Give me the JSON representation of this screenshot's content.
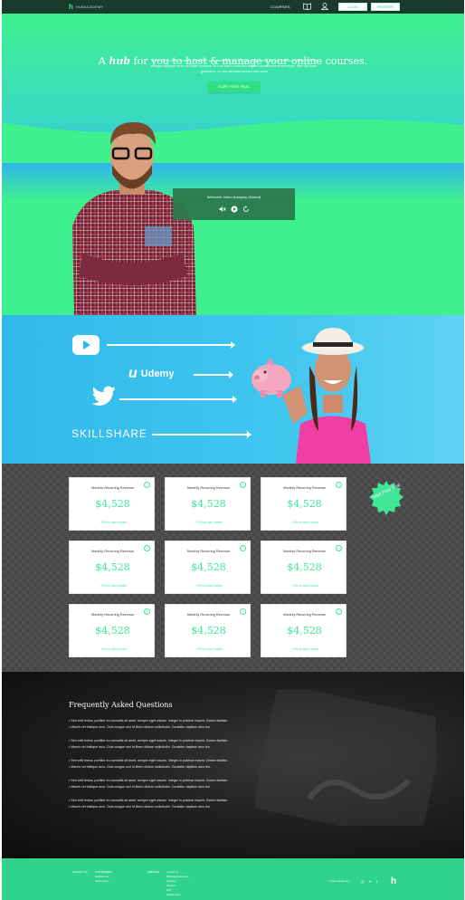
{
  "nav": {
    "logo_text": "HUBACADEMY",
    "courses": "COURSES",
    "login": "LOGIN",
    "register": "REGISTER"
  },
  "hero": {
    "title_pre": "A",
    "title_bold": "hub",
    "title_post": "for you to host & manage your online courses.",
    "subtitle": "Lorem ipsum dolor sit amet, consetetur sadipscing elitr, sed diam nonumy eirmod tempor invidunt ut labore et dolore magna aliquyam erat, sed diam voluptua. At vero eos et accusam et justo duo dolores et ea rebum. Stet clita kasd gubergren, no sea takimata sanctus est Lorem.",
    "cta": "START FREE TRIAL",
    "video_title": "Welcome Video Autoplay (Muted)"
  },
  "platforms": {
    "udemy": "Udemy",
    "skillshare": "SKILLSHARE"
  },
  "stats": {
    "badge": "Start Free Trial",
    "cards": [
      {
        "title": "Monthly Recurring Revenue",
        "value": "$4,528",
        "change": "9% vs last month"
      },
      {
        "title": "Monthly Recurring Revenue",
        "value": "$4,528",
        "change": "9% vs last month"
      },
      {
        "title": "Monthly Recurring Revenue",
        "value": "$4,528",
        "change": "9% vs last month"
      },
      {
        "title": "Monthly Recurring Revenue",
        "value": "$4,528",
        "change": "9% vs last month"
      },
      {
        "title": "Monthly Recurring Revenue",
        "value": "$4,528",
        "change": "9% vs last month"
      },
      {
        "title": "Monthly Recurring Revenue",
        "value": "$4,528",
        "change": "9% vs last month"
      },
      {
        "title": "Monthly Recurring Revenue",
        "value": "$4,528",
        "change": "9% vs last month"
      },
      {
        "title": "Monthly Recurring Revenue",
        "value": "$4,528",
        "change": "9% vs last month"
      },
      {
        "title": "Monthly Recurring Revenue",
        "value": "$4,528",
        "change": "9% vs last month"
      }
    ]
  },
  "faq": {
    "title": "Frequently Asked Questions",
    "items": [
      {
        "q": "• Sed velit lectus, porttitor eu convallis sit amet, semper eget mauris. Integer in pulvinar mauris. Donec facilisis.",
        "a": "• Mauris vel tristique arcu. Duis congue orci id libero dictum sollicitudin. Curabitur dapibus arcu leo."
      },
      {
        "q": "• Sed velit lectus, porttitor eu convallis sit amet, semper eget mauris. Integer in pulvinar mauris. Donec facilisis.",
        "a": "• Mauris vel tristique arcu. Duis congue orci id libero dictum sollicitudin. Curabitur dapibus arcu leo."
      },
      {
        "q": "• Sed velit lectus, porttitor eu convallis sit amet, semper eget mauris. Integer in pulvinar mauris. Donec facilisis.",
        "a": "• Mauris vel tristique arcu. Duis congue orci id libero dictum sollicitudin. Curabitur dapibus arcu leo."
      },
      {
        "q": "• Sed velit lectus, porttitor eu convallis sit amet, semper eget mauris. Integer in pulvinar mauris. Donec facilisis.",
        "a": "• Mauris vel tristique arcu. Duis congue orci id libero dictum sollicitudin. Curabitur dapibus arcu leo."
      },
      {
        "q": "• Sed velit lectus, porttitor eu convallis sit amet, semper eget mauris. Integer in pulvinar mauris. Donec facilisis.",
        "a": "• Mauris vel tristique arcu. Duis congue orci id libero dictum sollicitudin. Curabitur dapibus arcu leo."
      }
    ]
  },
  "footer": {
    "col1": [
      "CONTACT US"
    ],
    "col2": [
      "OUR ADDRESS",
      "Neighbors lan",
      "Nearby Area"
    ],
    "col3": [
      "SERVICES"
    ],
    "col4": [
      "Contact Us",
      "Marketing Resources",
      "Shopping",
      "Services",
      "FAQ",
      "Selling Guide"
    ],
    "copyright": "© www.website.com",
    "social": [
      "instagram-icon",
      "twitter-icon",
      "facebook-icon"
    ]
  },
  "colors": {
    "accent": "#3fe695",
    "nav_bg": "#1b3a2e",
    "blue": "#30b9ea",
    "footer_bg": "#2fd38b"
  }
}
